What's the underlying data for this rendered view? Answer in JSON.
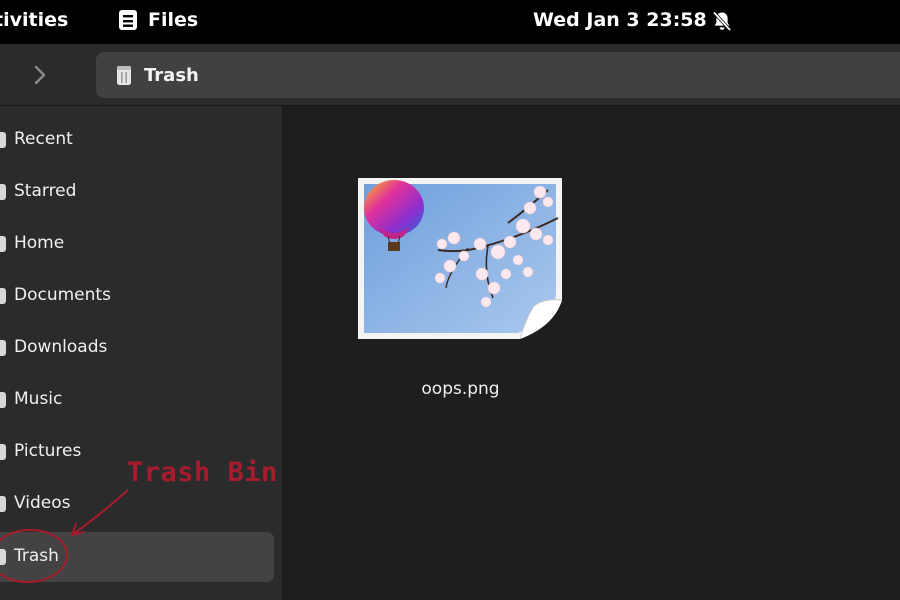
{
  "topbar": {
    "activities": "tivities",
    "app_name": "Files",
    "clock": "Wed Jan 3  23:58",
    "notification_icon": "bell-off-icon"
  },
  "header": {
    "forward_icon": "chevron-right-icon",
    "path_icon": "trash-icon",
    "path_label": "Trash"
  },
  "sidebar": {
    "items": [
      {
        "label": "Recent",
        "icon": "clock-icon"
      },
      {
        "label": "Starred",
        "icon": "star-icon"
      },
      {
        "label": "Home",
        "icon": "home-icon"
      },
      {
        "label": "Documents",
        "icon": "document-icon"
      },
      {
        "label": "Downloads",
        "icon": "download-icon"
      },
      {
        "label": "Music",
        "icon": "music-icon"
      },
      {
        "label": "Pictures",
        "icon": "picture-icon"
      },
      {
        "label": "Videos",
        "icon": "video-icon"
      },
      {
        "label": "Trash",
        "icon": "trash-icon",
        "selected": true
      }
    ]
  },
  "main": {
    "files": [
      {
        "name": "oops.png",
        "icon": "image-thumbnail"
      }
    ]
  },
  "annotation": {
    "text": "Trash Bin",
    "color": "#a51d2d"
  }
}
